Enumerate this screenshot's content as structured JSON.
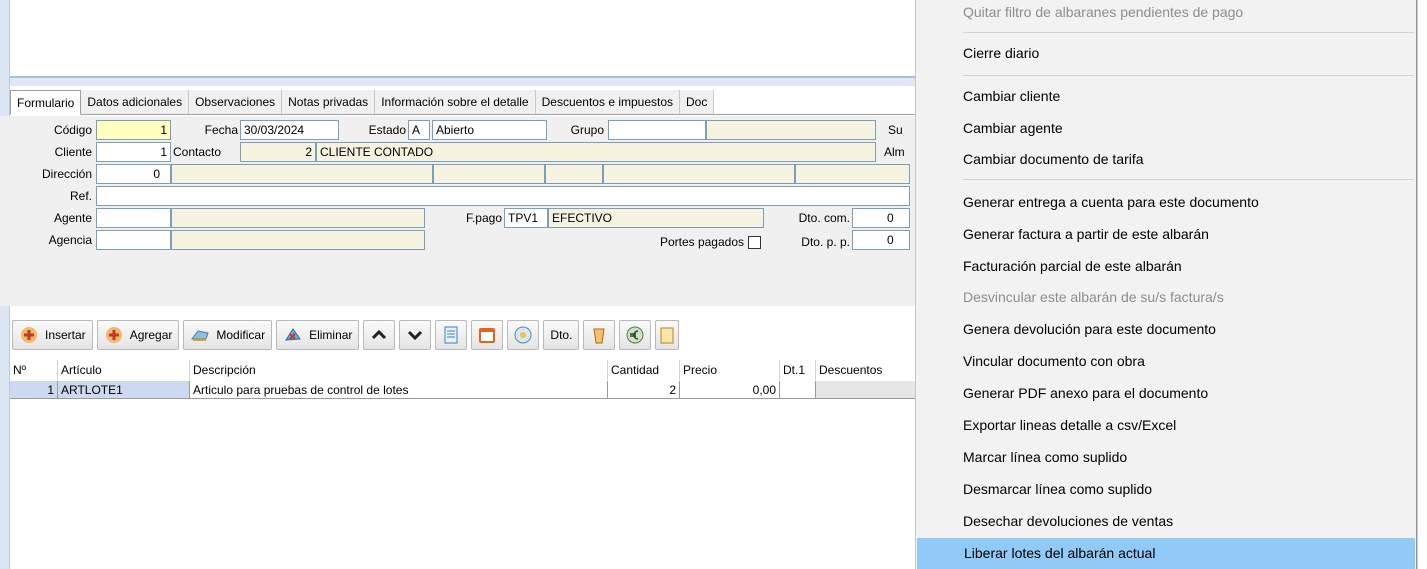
{
  "tabs": [
    "Formulario",
    "Datos adicionales",
    "Observaciones",
    "Notas privadas",
    "Información sobre el detalle",
    "Descuentos e impuestos",
    "Doc"
  ],
  "form": {
    "codigo_label": "Código",
    "codigo_value": "1",
    "fecha_label": "Fecha",
    "fecha_value": "30/03/2024",
    "estado_label": "Estado",
    "estado_code": "A",
    "estado_text": "Abierto",
    "grupo_label": "Grupo",
    "su_label": "Su",
    "cliente_label": "Cliente",
    "cliente_value": "1",
    "contacto_label": "Contacto",
    "contacto_value": "2",
    "contacto_name": "CLIENTE CONTADO",
    "alm_label": "Alm",
    "direccion_label": "Dirección",
    "direccion_value": "0",
    "ref_label": "Ref.",
    "agente_label": "Agente",
    "fpago_label": "F.pago",
    "fpago_code": "TPV1",
    "fpago_text": "EFECTIVO",
    "dto_com_label": "Dto. com.",
    "dto_com_value": "0",
    "agencia_label": "Agencia",
    "portes_label": "Portes pagados",
    "dto_pp_label": "Dto. p. p.",
    "dto_pp_value": "0"
  },
  "toolbar": {
    "insertar": "Insertar",
    "agregar": "Agregar",
    "modificar": "Modificar",
    "eliminar": "Eliminar",
    "dto": "Dto."
  },
  "grid": {
    "headers": [
      "Nº",
      "Artículo",
      "Descripción",
      "Cantidad",
      "Precio",
      "Dt.1",
      "Descuentos"
    ],
    "rows": [
      {
        "n": "1",
        "articulo": "ARTLOTE1",
        "descripcion": "Articulo para pruebas de control de lotes",
        "cantidad": "2",
        "precio": "0,00",
        "dt1": "",
        "descuentos": ""
      }
    ]
  },
  "menu": {
    "items": [
      "Quitar filtro de albaranes pendientes de pago",
      "Cierre diario",
      "Cambiar cliente",
      "Cambiar agente",
      "Cambiar documento de tarifa",
      "Generar entrega a cuenta para este documento",
      "Generar factura a partir de este albarán",
      "Facturación parcial de este albarán",
      "Desvincular este albarán de su/s factura/s",
      "Genera devolución para este documento",
      "Vincular documento con obra",
      "Generar PDF anexo para el documento",
      "Exportar lineas detalle a csv/Excel",
      "Marcar línea como suplido",
      "Desmarcar línea como suplido",
      "Desechar devoluciones de ventas",
      "Liberar lotes del albarán actual"
    ]
  }
}
